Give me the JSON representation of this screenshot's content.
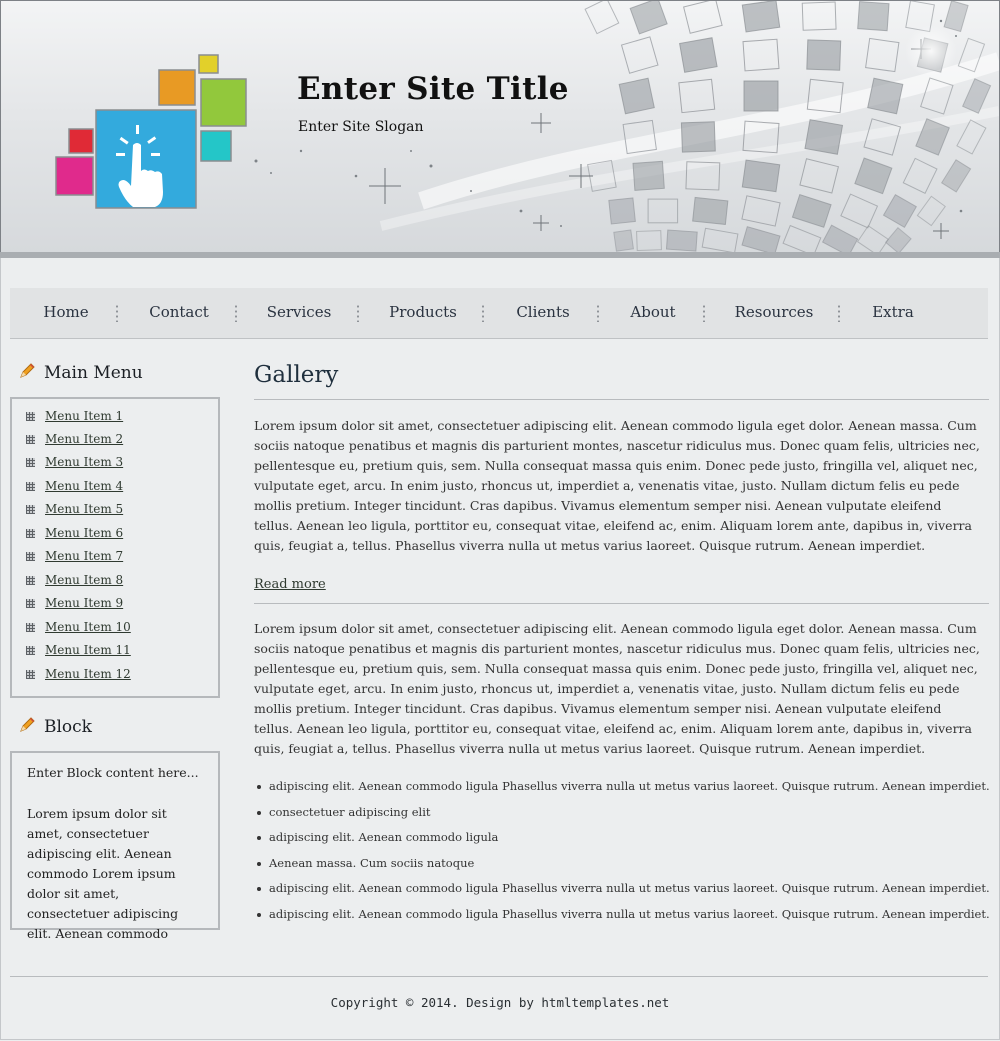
{
  "header": {
    "title": "Enter Site Title",
    "slogan": "Enter Site Slogan"
  },
  "nav": {
    "items": [
      "Home",
      "Contact",
      "Services",
      "Products",
      "Clients",
      "About",
      "Resources",
      "Extra"
    ]
  },
  "sidebar": {
    "menu_heading": "Main Menu",
    "menu_items": [
      "Menu Item 1",
      "Menu Item 2",
      "Menu Item 3",
      "Menu Item 4",
      "Menu Item 5",
      "Menu Item 6",
      "Menu Item 7",
      "Menu Item 8",
      "Menu Item 9",
      "Menu Item 10",
      "Menu Item 11",
      "Menu Item 12"
    ],
    "block_heading": "Block",
    "block_intro": "Enter Block content here...",
    "block_text": "Lorem ipsum dolor sit amet, consectetuer adipiscing elit. Aenean commodo Lorem ipsum dolor sit amet, consectetuer adipiscing elit. Aenean commodo"
  },
  "main": {
    "title": "Gallery",
    "paragraph_1": "Lorem ipsum dolor sit amet, consectetuer adipiscing elit. Aenean commodo ligula eget dolor. Aenean massa. Cum sociis natoque penatibus et magnis dis parturient montes, nascetur ridiculus mus. Donec quam felis, ultricies nec, pellentesque eu, pretium quis, sem. Nulla consequat massa quis enim. Donec pede justo, fringilla vel, aliquet nec, vulputate eget, arcu. In enim justo, rhoncus ut, imperdiet a, venenatis vitae, justo. Nullam dictum felis eu pede mollis pretium. Integer tincidunt. Cras dapibus. Vivamus elementum semper nisi. Aenean vulputate eleifend tellus. Aenean leo ligula, porttitor eu, consequat vitae, eleifend ac, enim. Aliquam lorem ante, dapibus in, viverra quis, feugiat a, tellus. Phasellus viverra nulla ut metus varius laoreet. Quisque rutrum. Aenean imperdiet.",
    "read_more": "Read more",
    "paragraph_2": "Lorem ipsum dolor sit amet, consectetuer adipiscing elit. Aenean commodo ligula eget dolor. Aenean massa. Cum sociis natoque penatibus et magnis dis parturient montes, nascetur ridiculus mus. Donec quam felis, ultricies nec, pellentesque eu, pretium quis, sem. Nulla consequat massa quis enim. Donec pede justo, fringilla vel, aliquet nec, vulputate eget, arcu. In enim justo, rhoncus ut, imperdiet a, venenatis vitae, justo. Nullam dictum felis eu pede mollis pretium. Integer tincidunt. Cras dapibus. Vivamus elementum semper nisi. Aenean vulputate eleifend tellus. Aenean leo ligula, porttitor eu, consequat vitae, eleifend ac, enim. Aliquam lorem ante, dapibus in, viverra quis, feugiat a, tellus. Phasellus viverra nulla ut metus varius laoreet. Quisque rutrum. Aenean imperdiet.",
    "list_items": [
      "adipiscing elit. Aenean commodo ligula Phasellus viverra nulla ut metus varius laoreet. Quisque rutrum. Aenean imperdiet.",
      "consectetuer adipiscing elit",
      "adipiscing elit. Aenean commodo ligula",
      "Aenean massa. Cum sociis natoque",
      "adipiscing elit. Aenean commodo ligula Phasellus viverra nulla ut metus varius laoreet. Quisque rutrum. Aenean imperdiet.",
      "adipiscing elit. Aenean commodo ligula Phasellus viverra nulla ut metus varius laoreet. Quisque rutrum. Aenean imperdiet."
    ]
  },
  "footer": {
    "copyright": "Copyright © 2014. Design by htmltemplates.net"
  },
  "icons": {
    "logo": "touch-hand-logo-icon",
    "heading": "pencil-icon",
    "menu_bullet": "grid-bullet-icon"
  },
  "colors": {
    "logo_blue": "#33aadd",
    "logo_orange": "#e89a24",
    "logo_yellow": "#e2d02a",
    "logo_green": "#92c83c",
    "logo_red": "#e02a36",
    "logo_pink": "#e02a8c",
    "logo_teal": "#24c6c8"
  }
}
